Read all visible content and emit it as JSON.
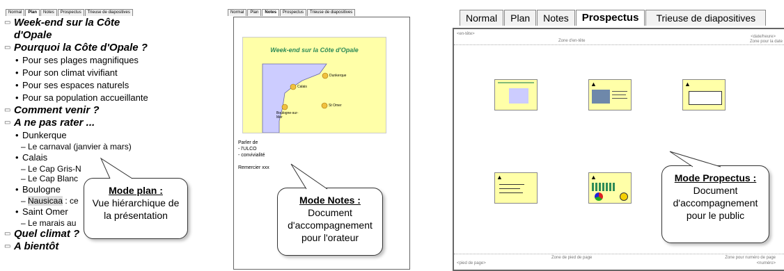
{
  "panel1": {
    "tabs": [
      "Normal",
      "Plan",
      "Notes",
      "Prospectus",
      "Trieuse de diapositives"
    ],
    "outline": {
      "s1": "Week-end sur la Côte",
      "s1b": "d'Opale",
      "s2": "Pourquoi la Côte d'Opale ?",
      "s2_b1": "Pour ses plages magnifiques",
      "s2_b2": "Pour son climat vivifiant",
      "s2_b3": "Pour ses espaces naturels",
      "s2_b4": "Pour sa population accueillante",
      "s3": "Comment venir ?",
      "s4": "A ne pas rater ...",
      "s4_dunkerque": "Dunkerque",
      "s4_carnaval": "Le carnaval (janvier à mars)",
      "s4_calais": "Calais",
      "s4_gris_nez": "Le Cap Gris-N",
      "s4_blanc_nez": "Le Cap Blanc",
      "s4_boulogne": "Boulogne",
      "s4_nausicaa": "Nausicaa",
      "s4_nausicaa_rest": " : ce",
      "s4_saint_omer": "Saint Omer",
      "s4_marais": "Le marais au",
      "s5": "Quel climat ?",
      "s6": "A bientôt"
    },
    "callout": {
      "title": "Mode plan :",
      "line1": "Vue hiérarchique de",
      "line2": "la présentation"
    }
  },
  "panel2": {
    "tabs": [
      "Normal",
      "Plan",
      "Notes",
      "Prospectus",
      "Trieuse de diapositives"
    ],
    "slide_title": "Week-end sur la Côte d'Opale",
    "map_labels": {
      "calais": "Calais",
      "dunkerque": "Dunkerque",
      "boulogne": "Boulogne-sur-Mer",
      "st_omer": "St Omer"
    },
    "notes_lines": [
      "Parler de",
      "- l'ULCO",
      "- convivialité",
      "",
      "Remercier xxx"
    ],
    "callout": {
      "title": "Mode Notes :",
      "line1": "Document",
      "line2": "d'accompagnement",
      "line3": "pour l'orateur"
    }
  },
  "panel3": {
    "tabs": [
      "Normal",
      "Plan",
      "Notes",
      "Prospectus",
      "Trieuse de diapositives"
    ],
    "placeholders": {
      "top_left": "<en-tête>",
      "top_center": "Zone d'en-tête",
      "top_right_1": "<date/heure>",
      "top_right_2": "Zone pour la date",
      "bottom_left": "<pied de page>",
      "bottom_center": "Zone de pied de page",
      "bottom_right_1": "Zone pour numéro de page",
      "bottom_right_2": "<numéro>"
    },
    "callout": {
      "title": "Mode Propectus :",
      "line1": "Document",
      "line2": "d'accompagnement",
      "line3": "pour le public"
    }
  },
  "colors": {
    "slide_bg": "#ffffa8",
    "slide_title": "#2e8b57",
    "map_land": "#ccccff"
  }
}
